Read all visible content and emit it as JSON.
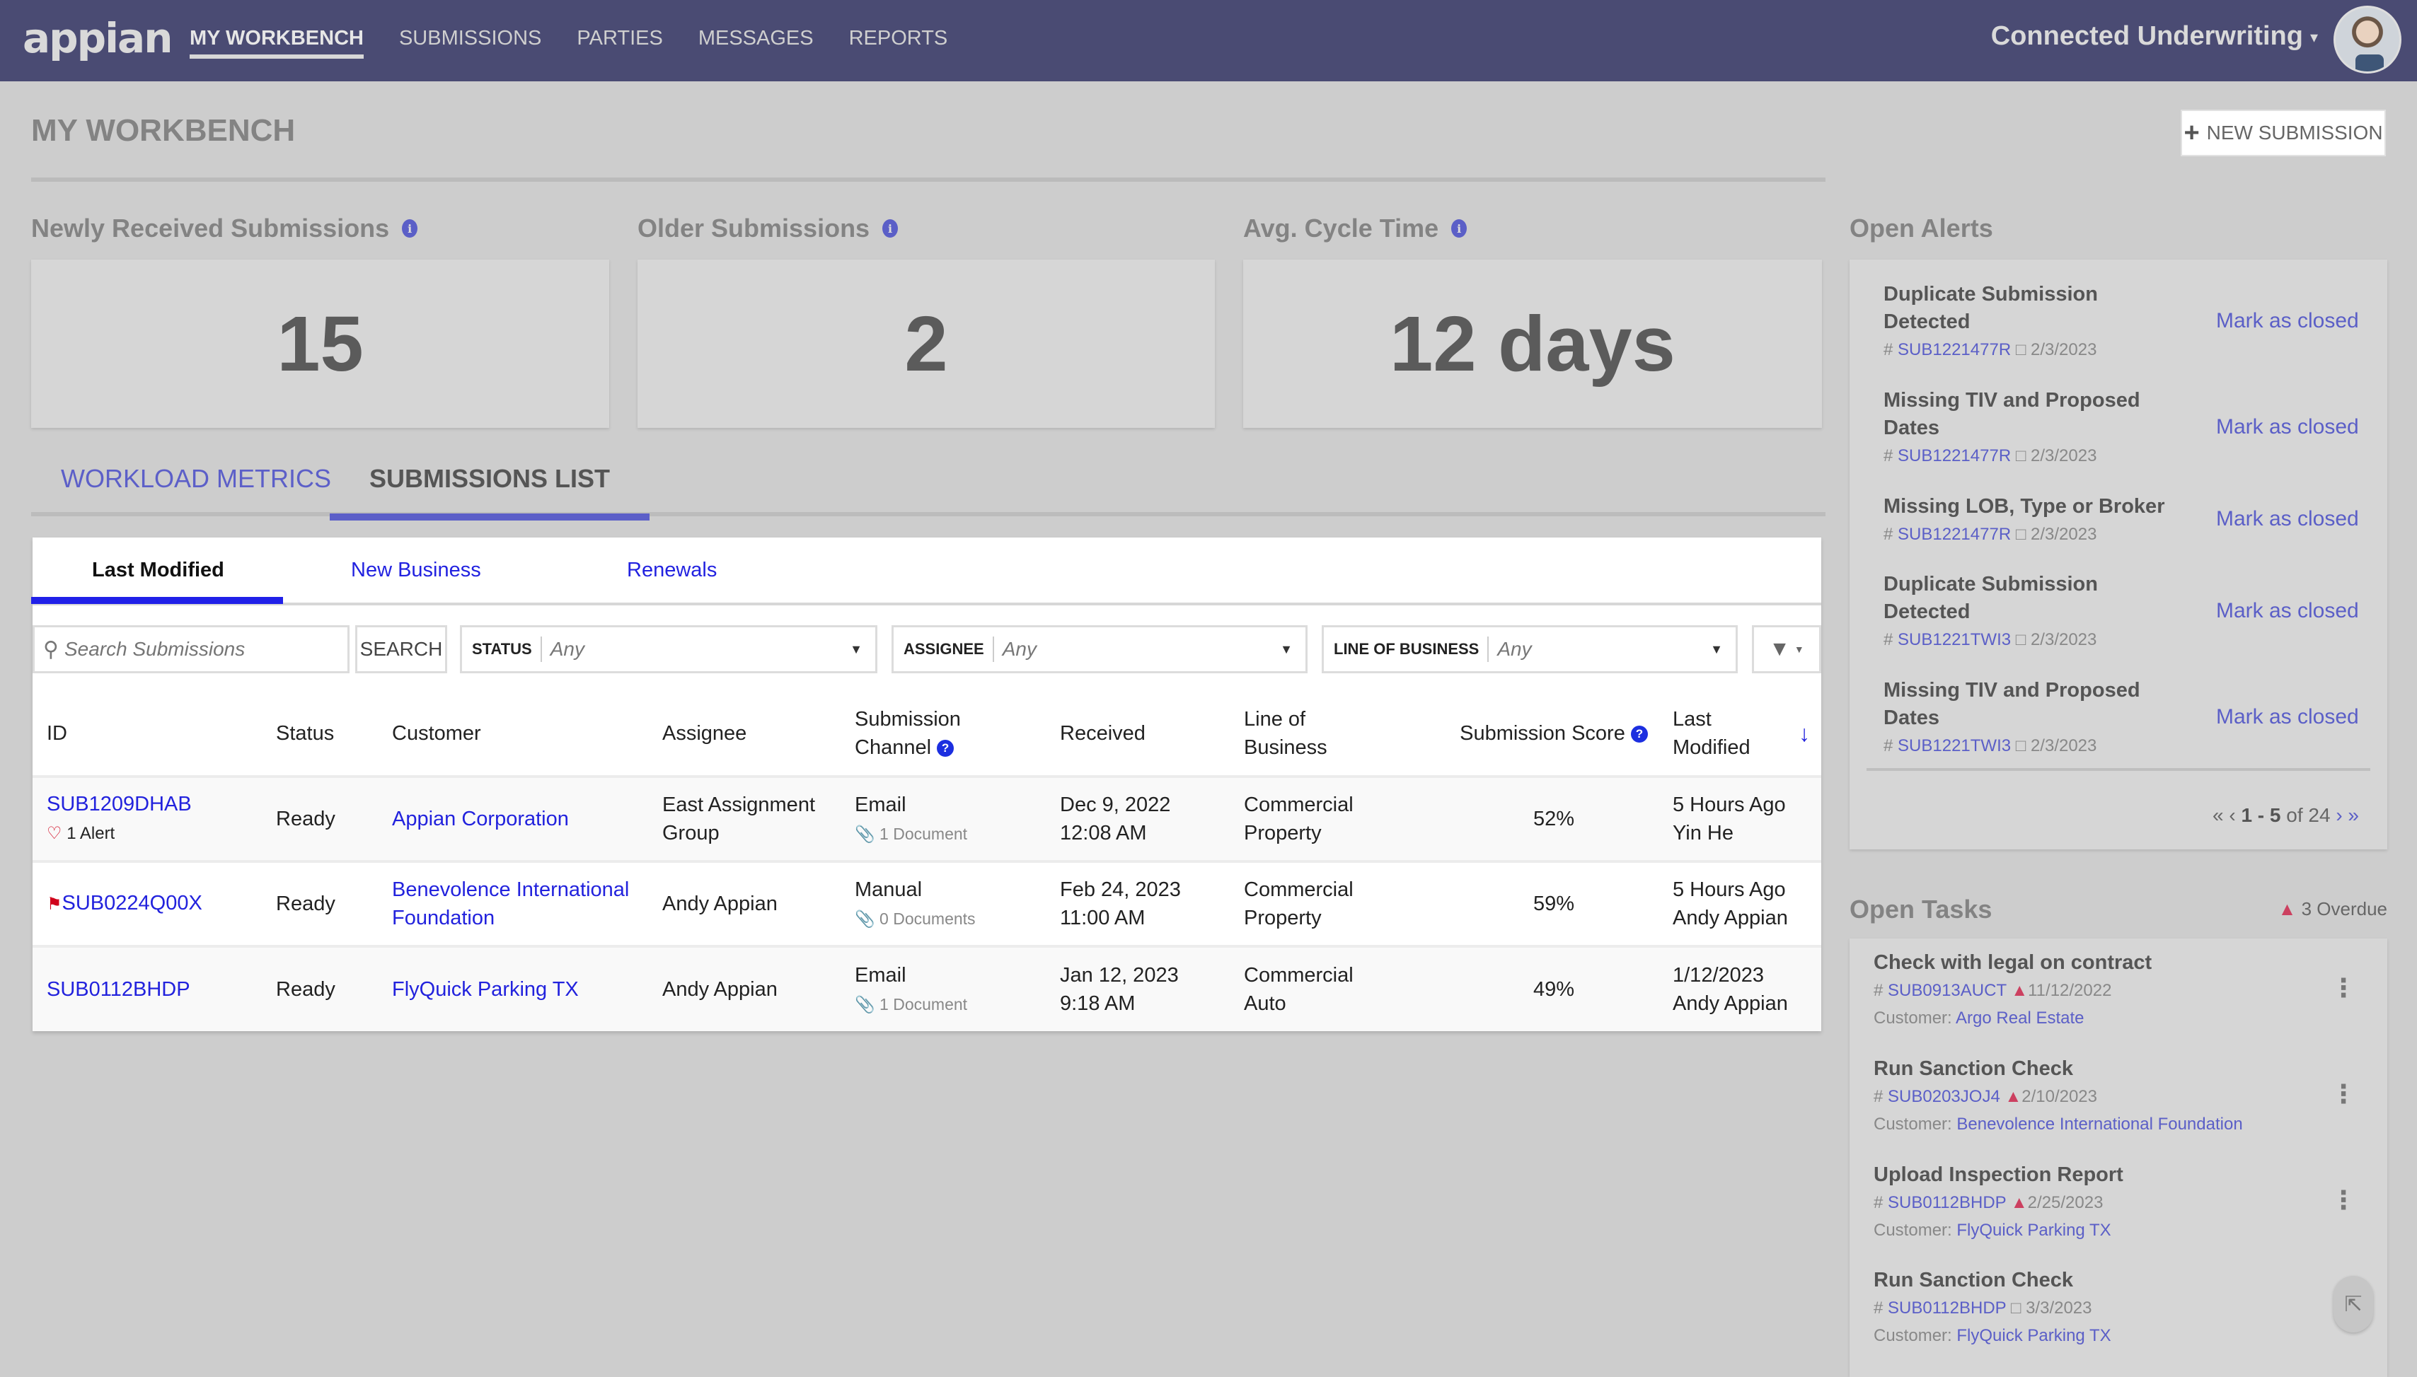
{
  "header": {
    "logo": "appian",
    "nav": [
      {
        "label": "MY WORKBENCH",
        "active": true
      },
      {
        "label": "SUBMISSIONS"
      },
      {
        "label": "PARTIES"
      },
      {
        "label": "MESSAGES"
      },
      {
        "label": "REPORTS"
      }
    ],
    "site_name": "Connected Underwriting",
    "site_caret": "▾",
    "avatar_icon": "user-avatar"
  },
  "page": {
    "title": "MY WORKBENCH",
    "new_submission_label": "NEW SUBMISSION",
    "new_submission_icon": "+"
  },
  "metrics": [
    {
      "label": "Newly Received Submissions",
      "value": "15",
      "info_icon": "i"
    },
    {
      "label": "Older Submissions",
      "value": "2",
      "info_icon": "i"
    },
    {
      "label": "Avg. Cycle Time",
      "value": "12 days",
      "info_icon": "i"
    }
  ],
  "main_tabs": [
    {
      "label": "WORKLOAD METRICS"
    },
    {
      "label": "SUBMISSIONS LIST",
      "active": true
    }
  ],
  "sub_tabs": [
    {
      "label": "Last Modified",
      "active": true
    },
    {
      "label": "New Business"
    },
    {
      "label": "Renewals"
    }
  ],
  "filters": {
    "search_placeholder": "Search Submissions",
    "search_icon": "🔍",
    "search_button": "SEARCH",
    "status": {
      "label": "STATUS",
      "value": "Any"
    },
    "assignee": {
      "label": "ASSIGNEE",
      "value": "Any"
    },
    "line_of_business": {
      "label": "LINE OF BUSINESS",
      "value": "Any"
    },
    "dropdown_icon": "▼",
    "filter_icon": "▼"
  },
  "table": {
    "columns": [
      "ID",
      "Status",
      "Customer",
      "Assignee",
      "Submission Channel",
      "Received",
      "Line of Business",
      "Submission Score",
      "Last Modified"
    ],
    "column_lines": {
      "channel": [
        "Submission",
        "Channel"
      ],
      "lob": [
        "Line of",
        "Business"
      ],
      "modified": [
        "Last",
        "Modified"
      ]
    },
    "help_icon": "?",
    "sort_icon": "↓",
    "rows": [
      {
        "id": "SUB1209DHAB",
        "alert": "1 Alert",
        "flag": false,
        "status": "Ready",
        "customer": "Appian Corporation",
        "assignee": "East Assignment Group",
        "channel": "Email",
        "docs": "1 Document",
        "received_date": "Dec 9, 2022",
        "received_time": "12:08 AM",
        "lob": "Commercial Property",
        "score": "52%",
        "modified": "5 Hours Ago",
        "modified_by": "Yin He"
      },
      {
        "id": "SUB0224Q00X",
        "alert": "",
        "flag": true,
        "status": "Ready",
        "customer": "Benevolence International Foundation",
        "assignee": "Andy Appian",
        "channel": "Manual",
        "docs": "0 Documents",
        "received_date": "Feb 24, 2023",
        "received_time": "11:00 AM",
        "lob": "Commercial Property",
        "score": "59%",
        "modified": "5 Hours Ago",
        "modified_by": "Andy Appian"
      },
      {
        "id": "SUB0112BHDP",
        "alert": "",
        "flag": false,
        "status": "Ready",
        "customer": "FlyQuick Parking TX",
        "assignee": "Andy Appian",
        "channel": "Email",
        "docs": "1 Document",
        "received_date": "Jan 12, 2023",
        "received_time": "9:18 AM",
        "lob": "Commercial Auto",
        "score": "49%",
        "modified": "1/12/2023",
        "modified_by": "Andy Appian"
      }
    ]
  },
  "alerts": {
    "title": "Open Alerts",
    "close_label": "Mark as closed",
    "items": [
      {
        "title": "Duplicate Submission Detected",
        "id": "SUB1221477R",
        "date": "2/3/2023"
      },
      {
        "title": "Missing TIV and Proposed Dates",
        "id": "SUB1221477R",
        "date": "2/3/2023"
      },
      {
        "title": "Missing LOB, Type or Broker",
        "id": "SUB1221477R",
        "date": "2/3/2023"
      },
      {
        "title": "Duplicate Submission Detected",
        "id": "SUB1221TWI3",
        "date": "2/3/2023"
      },
      {
        "title": "Missing TIV and Proposed Dates",
        "id": "SUB1221TWI3",
        "date": "2/3/2023"
      }
    ],
    "pager": {
      "range": "1 - 5",
      "of": "of 24",
      "first": "«",
      "prev": "‹",
      "next": "›",
      "last": "»"
    }
  },
  "tasks": {
    "title": "Open Tasks",
    "overdue": "3 Overdue",
    "customer_prefix": "Customer:",
    "items": [
      {
        "title": "Check with legal on contract",
        "id": "SUB0913AUCT",
        "overdue": true,
        "date": "11/12/2022",
        "customer": "Argo Real Estate"
      },
      {
        "title": "Run Sanction Check",
        "id": "SUB0203JOJ4",
        "overdue": true,
        "date": "2/10/2023",
        "customer": "Benevolence International Foundation"
      },
      {
        "title": "Upload Inspection Report",
        "id": "SUB0112BHDP",
        "overdue": true,
        "date": "2/25/2023",
        "customer": "FlyQuick Parking TX"
      },
      {
        "title": "Run Sanction Check",
        "id": "SUB0112BHDP",
        "overdue": false,
        "date": "3/3/2023",
        "customer": "FlyQuick Parking TX"
      }
    ]
  },
  "colors": {
    "header_bg": "#4a4b73",
    "accent": "#5c5fc8",
    "link": "#2222dd",
    "alert_red": "#cc4060",
    "page_bg": "#cdcdcd"
  }
}
